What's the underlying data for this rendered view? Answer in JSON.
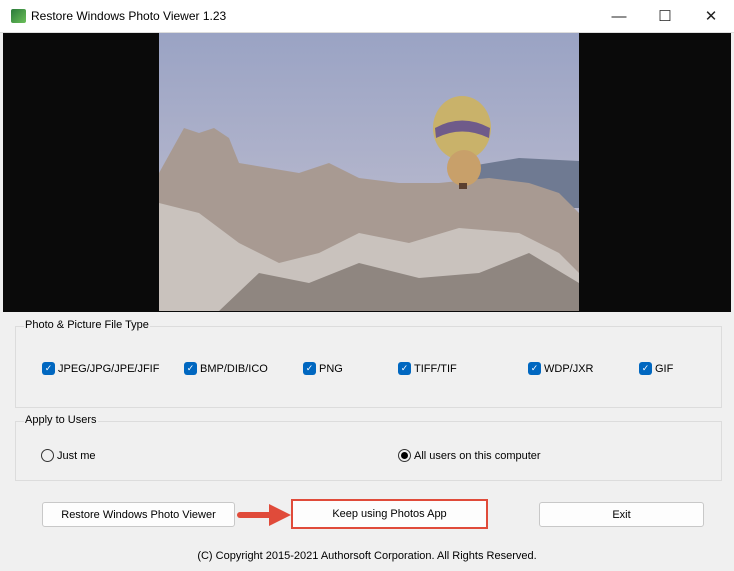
{
  "window": {
    "title": "Restore Windows Photo Viewer 1.23",
    "minimize": "—",
    "maximize": "☐",
    "close": "✕"
  },
  "file_types": {
    "label": "Photo & Picture File Type",
    "items": [
      {
        "label": "JPEG/JPG/JPE/JFIF",
        "checked": true
      },
      {
        "label": "BMP/DIB/ICO",
        "checked": true
      },
      {
        "label": "PNG",
        "checked": true
      },
      {
        "label": "TIFF/TIF",
        "checked": true
      },
      {
        "label": "WDP/JXR",
        "checked": true
      },
      {
        "label": "GIF",
        "checked": true
      }
    ]
  },
  "users": {
    "label": "Apply to Users",
    "just_me": "Just me",
    "all_users": "All users on this computer",
    "selected": "all_users"
  },
  "buttons": {
    "restore": "Restore Windows Photo Viewer",
    "keep": "Keep using Photos App",
    "exit": "Exit"
  },
  "check_glyph": "✓",
  "copyright": "(C) Copyright 2015-2021 Authorsoft Corporation. All Rights Reserved.",
  "colors": {
    "accent": "#0067c0",
    "highlight": "#e53935"
  }
}
